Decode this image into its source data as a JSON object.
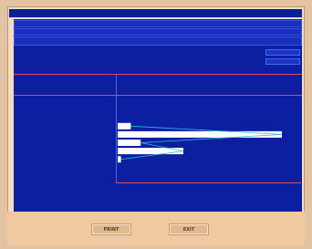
{
  "window": {
    "title": ""
  },
  "header_rows": [
    {
      "fields": [
        "",
        "",
        "",
        "",
        ""
      ]
    },
    {
      "fields": [
        "",
        "",
        "",
        "",
        "",
        ""
      ]
    },
    {
      "fields": [
        "",
        "",
        "",
        "",
        "",
        "",
        "",
        "",
        "",
        ""
      ]
    }
  ],
  "side_fields": {
    "values": [
      "",
      "",
      ""
    ]
  },
  "table": {
    "headers": [
      "",
      "",
      ""
    ],
    "rows": [
      {
        "from": "",
        "sep": "",
        "to": "",
        "count": ""
      },
      {
        "from": "",
        "sep": "",
        "to": "",
        "count": ""
      },
      {
        "from": "",
        "sep": "",
        "to": "",
        "count": ""
      },
      {
        "from": "",
        "sep": "",
        "to": "",
        "count": ""
      },
      {
        "from": "",
        "sep": "",
        "to": "",
        "count": ""
      },
      {
        "from": "",
        "sep": "",
        "to": "",
        "count": ""
      },
      {
        "from": "",
        "sep": "",
        "to": "",
        "count": ""
      },
      {
        "from": "",
        "sep": "",
        "to": "",
        "count": ""
      },
      {
        "from": "",
        "sep": "",
        "to": "",
        "count": ""
      },
      {
        "from": "",
        "sep": "",
        "to": "",
        "count": ""
      },
      {
        "from": "",
        "sep": "",
        "to": "",
        "count": ""
      }
    ]
  },
  "histogram": {
    "bar_fractions": [
      0,
      0,
      0,
      0.08,
      1.0,
      0.14,
      0.4,
      0.02,
      0,
      0,
      0
    ]
  },
  "buttons": {
    "print_label": "PRINT",
    "exit_label": "EXIT"
  },
  "colors": {
    "panel": "#0b1fa0",
    "accent": "#e04a6a",
    "background": "#f3dcc2"
  }
}
